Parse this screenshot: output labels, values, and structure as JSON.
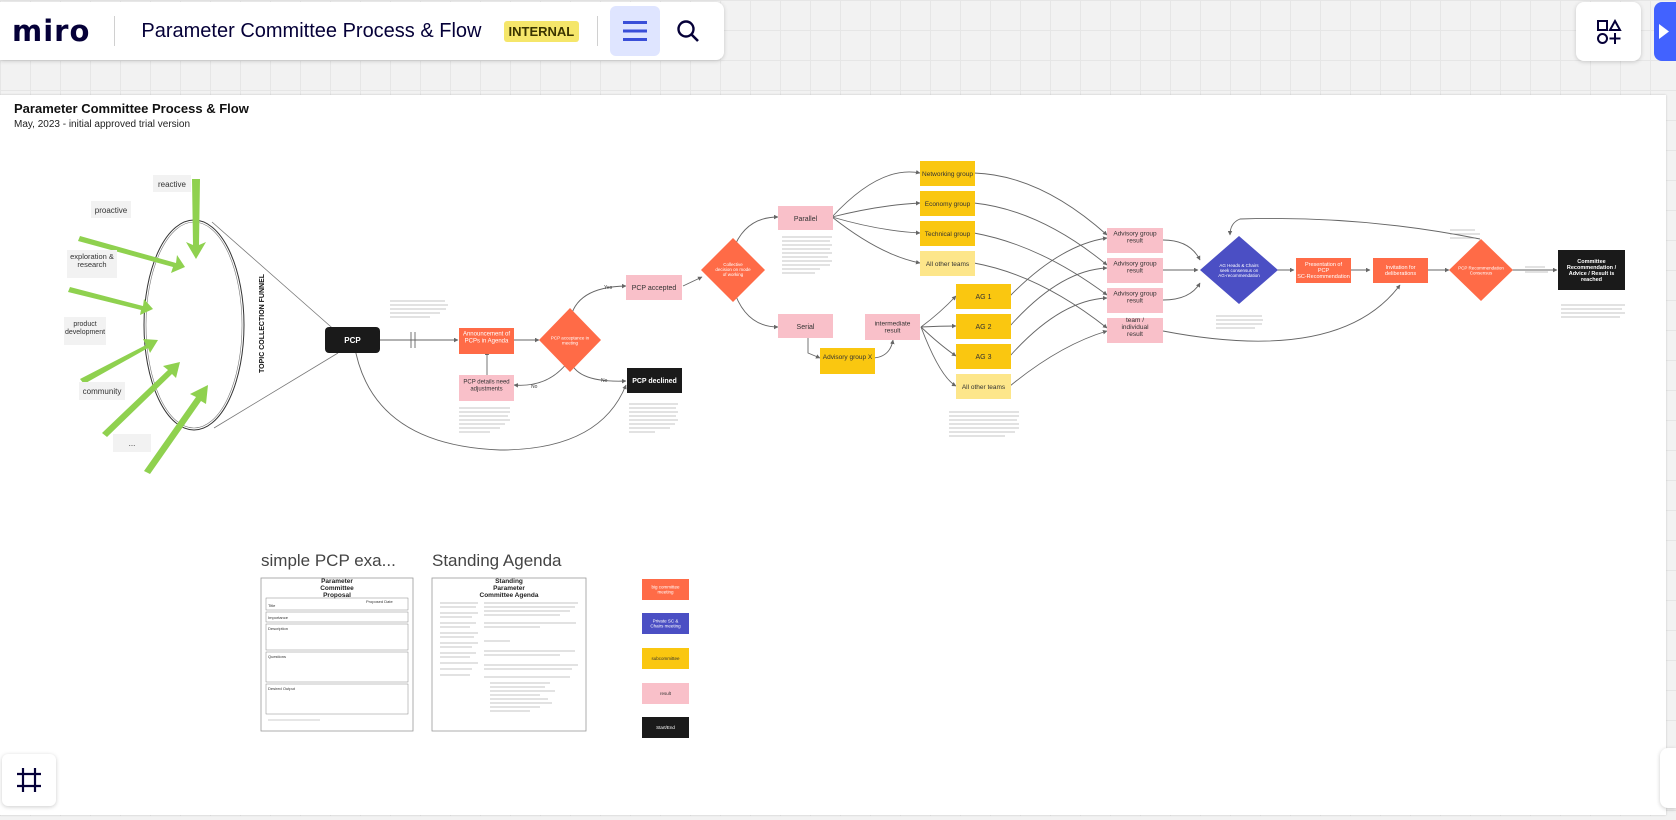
{
  "app": {
    "logo": "miro"
  },
  "header": {
    "board_title": "Parameter Committee Process & Flow",
    "badge": "INTERNAL"
  },
  "icons": {
    "menu": "hamburger-icon",
    "search": "search-icon",
    "shapes": "shapes-icon",
    "frames": "frame-icon",
    "present": "present-icon"
  },
  "colors": {
    "orange": "#ff6b47",
    "blue": "#4b4fc4",
    "yellow": "#fac710",
    "pink": "#f9c0c9",
    "black": "#1a1a1a",
    "green": "#8fd14f",
    "badge": "#f5e66a",
    "accent": "#4262ff"
  },
  "board": {
    "title": "Parameter Committee Process & Flow",
    "subtitle": "May, 2023 - initial approved trial version",
    "funnel_label": "TOPIC COLLECTION FUNNEL",
    "inputs": [
      "reactive",
      "proactive",
      "exploration & research",
      "product development",
      "community",
      "..."
    ],
    "nodes": {
      "pcp": "PCP",
      "announcement": "Announcement of PCPs in Agenda",
      "pcp_details": "PCP details need adjustments",
      "acceptance": "PCP acceptance in meeting",
      "pcp_accepted": "PCP accepted",
      "pcp_declined": "PCP declined",
      "collective": "Collective decision on mode of working",
      "parallel": "Parallel",
      "serial": "Serial",
      "intermediate": "intermediate result",
      "advisory_x": "Advisory group X",
      "networking": "Networking group",
      "economy": "Economy group",
      "technical": "Technical group",
      "all_other_1": "All other teams",
      "ag1": "AG 1",
      "ag2": "AG 2",
      "ag3": "AG 3",
      "all_other_2": "All other teams",
      "adv_result_1": "Advisory group result",
      "adv_result_2": "Advisory group result",
      "adv_result_3": "Advisory group result",
      "team_result": "team / individual result",
      "ag_heads": "AG Heads & Chairs seek consensus on AG-recommendation",
      "presentation": "Presentation of PCP SC-Recommendation",
      "invitation": "Invitation for deliberations",
      "consensus": "PCP Recommendation Consensus",
      "final": "Committee Recommendation / Advice / Result is reached"
    },
    "edge_labels": {
      "yes": "Yes",
      "no": "No"
    },
    "bottom": {
      "simple_title": "simple PCP exa...",
      "agenda_title": "Standing Agenda",
      "proposal_heading": "Parameter Committee Proposal",
      "proposal_rows": [
        "Title",
        "Proposed Date",
        "Importance",
        "Description",
        "Questions",
        "Desired Output"
      ],
      "agenda_heading": "Standing Parameter Committee Agenda"
    },
    "legend": [
      {
        "label": "big committee meeting",
        "color": "#ff6b47"
      },
      {
        "label": "Private SC & Chairs meeting",
        "color": "#4b4fc4"
      },
      {
        "label": "subcommittee",
        "color": "#fac710"
      },
      {
        "label": "result",
        "color": "#f9c0c9"
      },
      {
        "label": "Start/End",
        "color": "#1a1a1a"
      }
    ]
  }
}
